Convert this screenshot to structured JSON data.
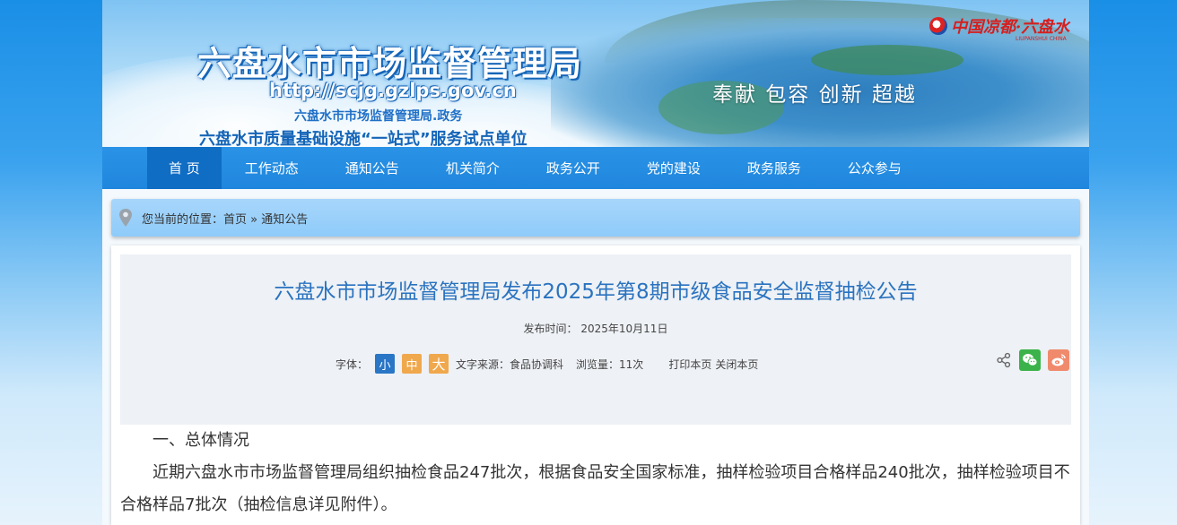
{
  "header": {
    "site_title": "六盘水市市场监督管理局",
    "site_url": "http://scjg.gzlps.gov.cn",
    "site_gov": "六盘水市市场监督管理局.政务",
    "site_slogan": "六盘水市质量基础设施“一站式”服务试点单位",
    "motto": "奉献 包容 创新 超越",
    "brand_text": "中国凉都·六盘水",
    "brand_sub": "LIUPANSHUI CHINA"
  },
  "nav": {
    "items": [
      {
        "label": "首 页",
        "active": true
      },
      {
        "label": "工作动态"
      },
      {
        "label": "通知公告"
      },
      {
        "label": "机关简介"
      },
      {
        "label": "政务公开"
      },
      {
        "label": "党的建设"
      },
      {
        "label": "政务服务"
      },
      {
        "label": "公众参与"
      }
    ]
  },
  "breadcrumb": {
    "prefix": "您当前的位置：",
    "home": "首页",
    "sep": " » ",
    "current": "通知公告"
  },
  "article": {
    "title": "六盘水市市场监督管理局发布2025年第8期市级食品安全监督抽检公告",
    "pub_time": "发布时间： 2025年10月11日",
    "font_label": "字体：",
    "font_small": "小",
    "font_mid": "中",
    "font_big": "大",
    "source": "文字来源：食品协调科",
    "views": "浏览量：11次",
    "print": "打印本页",
    "close": "关闭本页",
    "section1": "一、总体情况",
    "para1": "近期六盘水市市场监督管理局组织抽检食品247批次，根据食品安全国家标准，抽样检验项目合格样品240批次，抽样检验项目不合格样品7批次（抽检信息详见附件）。"
  },
  "colors": {
    "nav_bg": "#1f86dd",
    "nav_active": "#0f6dc4",
    "title_blue": "#2a73c0",
    "font_small_bg": "#2a76c6",
    "font_mid_bg": "#f0a84d",
    "wechat_green": "#3bb34a",
    "weibo_red": "#f08a6c"
  }
}
